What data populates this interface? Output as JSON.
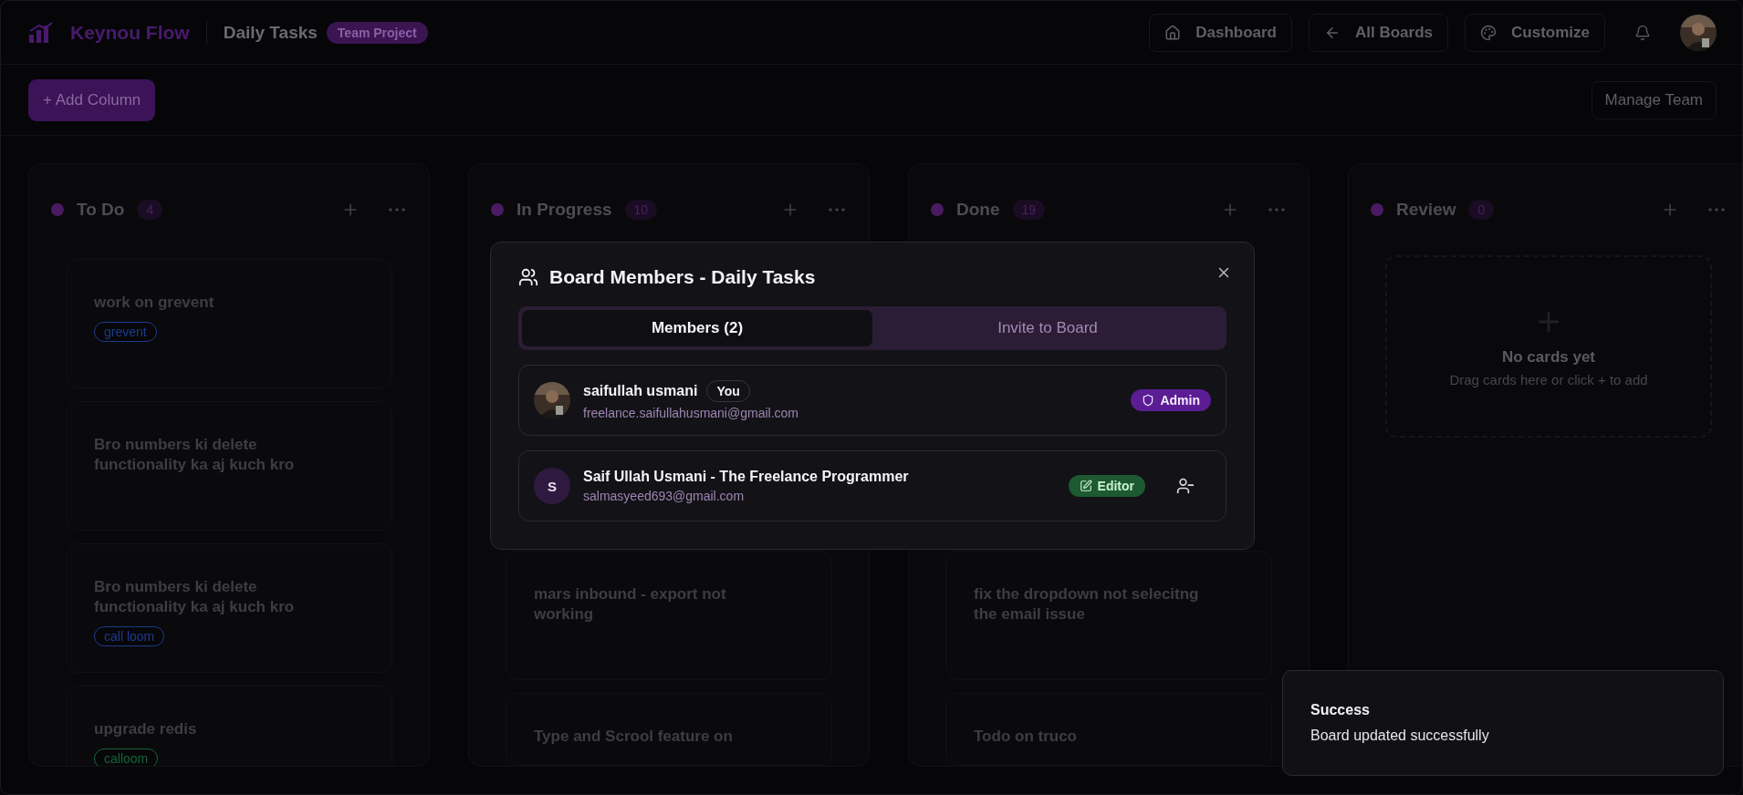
{
  "header": {
    "logo": "Keynou Flow",
    "board_title": "Daily Tasks",
    "board_badge": "Team Project",
    "nav": [
      {
        "label": "Dashboard",
        "kind": "home"
      },
      {
        "label": "All Boards",
        "kind": "back"
      },
      {
        "label": "Customize",
        "kind": "palette"
      }
    ]
  },
  "toolbar": {
    "add_column": "+ Add Column",
    "manage_team": "Manage Team"
  },
  "columns": [
    {
      "title": "To Do",
      "count": "4",
      "cards": [
        {
          "title": "work on grevent",
          "tags": [
            {
              "label": "grevent",
              "color": "#1e3a8a"
            }
          ]
        },
        {
          "title": "Bro numbers ki delete functionality ka aj kuch kro"
        },
        {
          "title": "Bro numbers ki delete functionality ka aj kuch kro",
          "tags": [
            {
              "label": "call loom",
              "color": "#1e3a8a"
            }
          ]
        },
        {
          "title": "upgrade redis",
          "tags": [
            {
              "label": "calloom",
              "color": "#166534"
            }
          ]
        }
      ]
    },
    {
      "title": "In Progress",
      "count": "10",
      "cards": [
        {
          "title": "mars inbound - export not working"
        },
        {
          "title": "Type and Scrool feature on"
        }
      ]
    },
    {
      "title": "Done",
      "count": "19",
      "cards": [
        {
          "title": "fix the dropdown not selecitng the email issue"
        },
        {
          "title": "Todo on truco"
        }
      ]
    },
    {
      "title": "Review",
      "count": "0",
      "empty": {
        "title": "No cards yet",
        "hint": "Drag cards here or click + to add"
      }
    }
  ],
  "modal": {
    "title": "Board Members - Daily Tasks",
    "tabs": [
      {
        "label": "Members (2)",
        "selected": true
      },
      {
        "label": "Invite to Board",
        "selected": false
      }
    ],
    "members": [
      {
        "name": "saifullah usmani",
        "badge": "You",
        "email": "freelance.saifullahusmani@gmail.com",
        "role": {
          "label": "Admin",
          "kind": "admin"
        },
        "removable": false
      },
      {
        "name": "Saif Ullah Usmani - The Freelance Programmer",
        "email": "salmasyeed693@gmail.com",
        "avatar": {
          "kind": "initial",
          "text": "S"
        },
        "role": {
          "label": "Editor",
          "kind": "editor"
        },
        "removable": true
      }
    ]
  },
  "toast": {
    "title": "Success",
    "message": "Board updated successfully"
  }
}
